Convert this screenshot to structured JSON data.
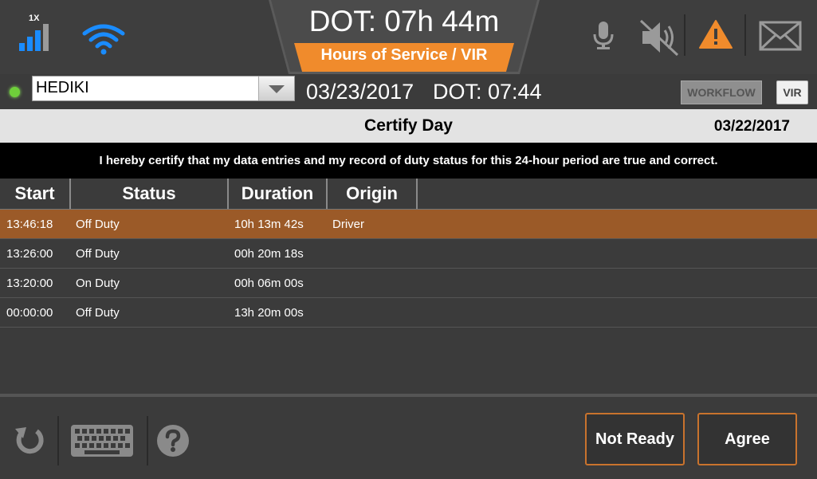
{
  "header": {
    "signal_label": "1X",
    "dot_remaining": "DOT: 07h 44m",
    "module_label": "Hours of Service / VIR",
    "icons": [
      "signal-bars-icon",
      "wifi-icon",
      "microphone-icon",
      "speaker-muted-icon",
      "warning-icon",
      "mail-icon"
    ]
  },
  "driver_bar": {
    "driver_name": "HEDIKI",
    "date": "03/23/2017",
    "dot_time": "DOT: 07:44",
    "workflow_label": "WORKFLOW",
    "vir_label": "VIR"
  },
  "certify": {
    "title": "Certify Day",
    "date": "03/22/2017",
    "statement": "I hereby certify that my data entries and my record of duty status for this 24-hour period are true and correct."
  },
  "table": {
    "columns": [
      "Start",
      "Status",
      "Duration",
      "Origin"
    ],
    "rows": [
      {
        "start": "13:46:18",
        "status": "Off Duty",
        "duration": "10h 13m 42s",
        "origin": "Driver",
        "selected": true
      },
      {
        "start": "13:26:00",
        "status": "Off Duty",
        "duration": "00h 20m 18s",
        "origin": "",
        "selected": false
      },
      {
        "start": "13:20:00",
        "status": "On Duty",
        "duration": "00h 06m 00s",
        "origin": "",
        "selected": false
      },
      {
        "start": "00:00:00",
        "status": "Off Duty",
        "duration": "13h 20m 00s",
        "origin": "",
        "selected": false
      }
    ]
  },
  "footer": {
    "not_ready_label": "Not Ready",
    "agree_label": "Agree"
  },
  "colors": {
    "accent_orange": "#f08b2c",
    "selected_row": "#9b5a28",
    "wifi_blue": "#1a8cff",
    "status_green": "#6fd03a"
  }
}
